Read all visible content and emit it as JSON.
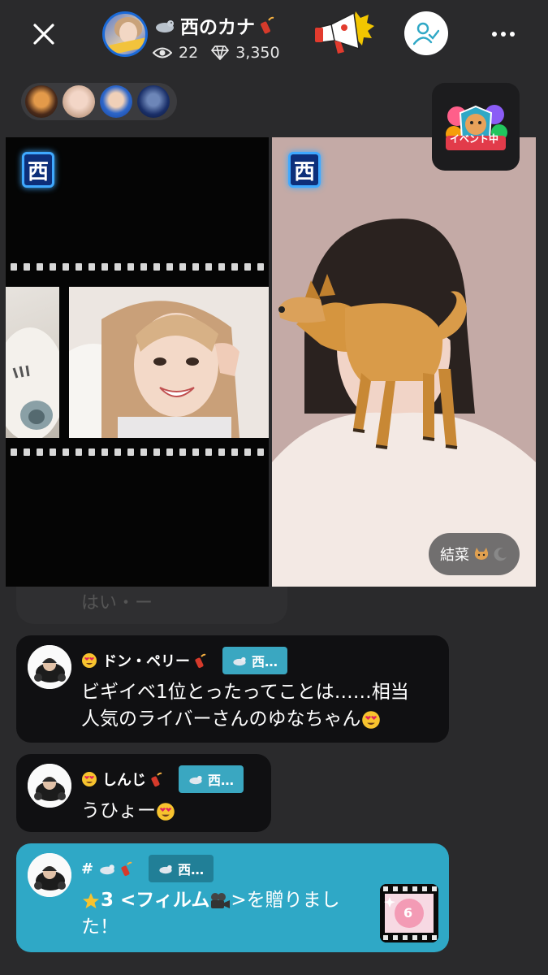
{
  "header": {
    "host_name": "西のカナ",
    "viewer_count": "22",
    "diamond_count": "3,350"
  },
  "left_video": {
    "nishi_badge": "西"
  },
  "right_video": {
    "nishi_badge": "西",
    "guest_name": "結菜"
  },
  "event_badge": {
    "label": "イベント中"
  },
  "chat": {
    "faded_text": "はい・ー",
    "messages": [
      {
        "user": "ドン・ペリー",
        "badge": "西…",
        "text_line1": "ビギイベ1位とったってことは……相当",
        "text_line2": "人気のライバーさんのゆなちゃん"
      },
      {
        "user": "しんじ",
        "badge": "西…",
        "text_line1": "うひょー"
      },
      {
        "user": "#",
        "badge": "西…",
        "text_line1": " 3 <フィルム",
        "text_line1b": " >を贈りまし",
        "text_line2": "た！",
        "gift_count": "6"
      }
    ]
  },
  "colors": {
    "background": "#2a2a2c",
    "chat_bubble": "#101012",
    "gift_bubble": "#2fa8c6",
    "badge": "#3aa7c1",
    "accent_blue": "#1a6ad8"
  }
}
